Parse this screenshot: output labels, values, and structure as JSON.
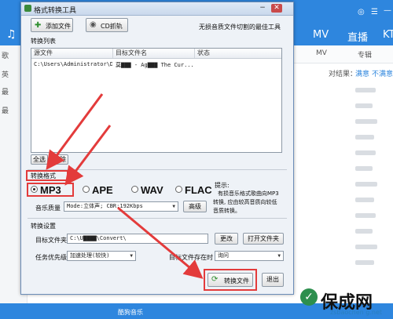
{
  "background_app": {
    "top_tabs": [
      "MV",
      "直播",
      "KT"
    ],
    "sub_tabs": [
      "MV",
      "专辑"
    ],
    "sidebar_items": [
      "歌",
      "英",
      "最",
      "最"
    ],
    "result_label": "对结果：",
    "result_link1": "满意",
    "result_link2": "不满意",
    "bottom_text": "酷狗音乐"
  },
  "dialog": {
    "title": "格式转换工具",
    "add_file_label": "添加文件",
    "cd_label": "CD抓轨",
    "slogan": "无损音质文件切割的最佳工具",
    "file_list_label": "转换列表",
    "columns": [
      "源文件",
      "目标文件名",
      "状态"
    ],
    "rows": [
      {
        "source": "C:\\Users\\Administrator\\D...",
        "target": "莫▇▇▇ - Ag▇▇▇ The Cur...",
        "status": ""
      }
    ],
    "select_all_label": "全选",
    "remove_label": "移除",
    "format_section_label": "转换格式",
    "formats": [
      "MP3",
      "APE",
      "WAV",
      "FLAC"
    ],
    "selected_format": "MP3",
    "tip_title": "提示:",
    "tip_lines": [
      "有损音乐格式歌曲向MP3",
      "转换, 应由较高音质向较低",
      "音质转换。"
    ],
    "quality_label": "音乐质量",
    "quality_value": "Mode:立体声; CBR:192Kbps",
    "advanced_label": "高级",
    "settings_label": "转换设置",
    "target_folder_label": "目标文件夹",
    "target_folder_value": "C:\\U▇▇▇▇\\Convert\\",
    "change_label": "更改",
    "open_folder_label": "打开文件夹",
    "priority_label": "任务优先级",
    "priority_value": "加速处理(较快)",
    "exists_label": "目标文件存在时",
    "exists_value": "询问",
    "convert_label": "转换文件",
    "exit_label": "退出"
  },
  "watermark": {
    "brand": "保成网",
    "url": "zsbaochen g.net"
  },
  "colors": {
    "app_blue": "#2e86de",
    "highlight_red": "#e33b3b"
  }
}
